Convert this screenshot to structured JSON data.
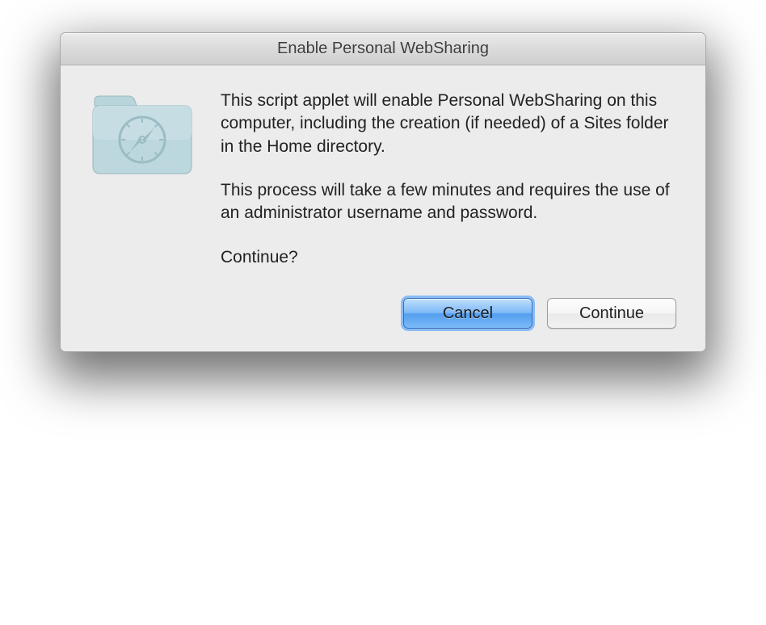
{
  "titlebar": {
    "title": "Enable Personal WebSharing"
  },
  "icon": {
    "name": "sites-folder-icon"
  },
  "message": {
    "para1": "This script applet will enable Personal WebSharing on this computer, including the creation (if needed) of a Sites folder in the Home directory.",
    "para2": "This process will take a few minutes and requires the use of an administrator username and password.",
    "para3": "Continue?"
  },
  "buttons": {
    "cancel": "Cancel",
    "continue": "Continue"
  }
}
